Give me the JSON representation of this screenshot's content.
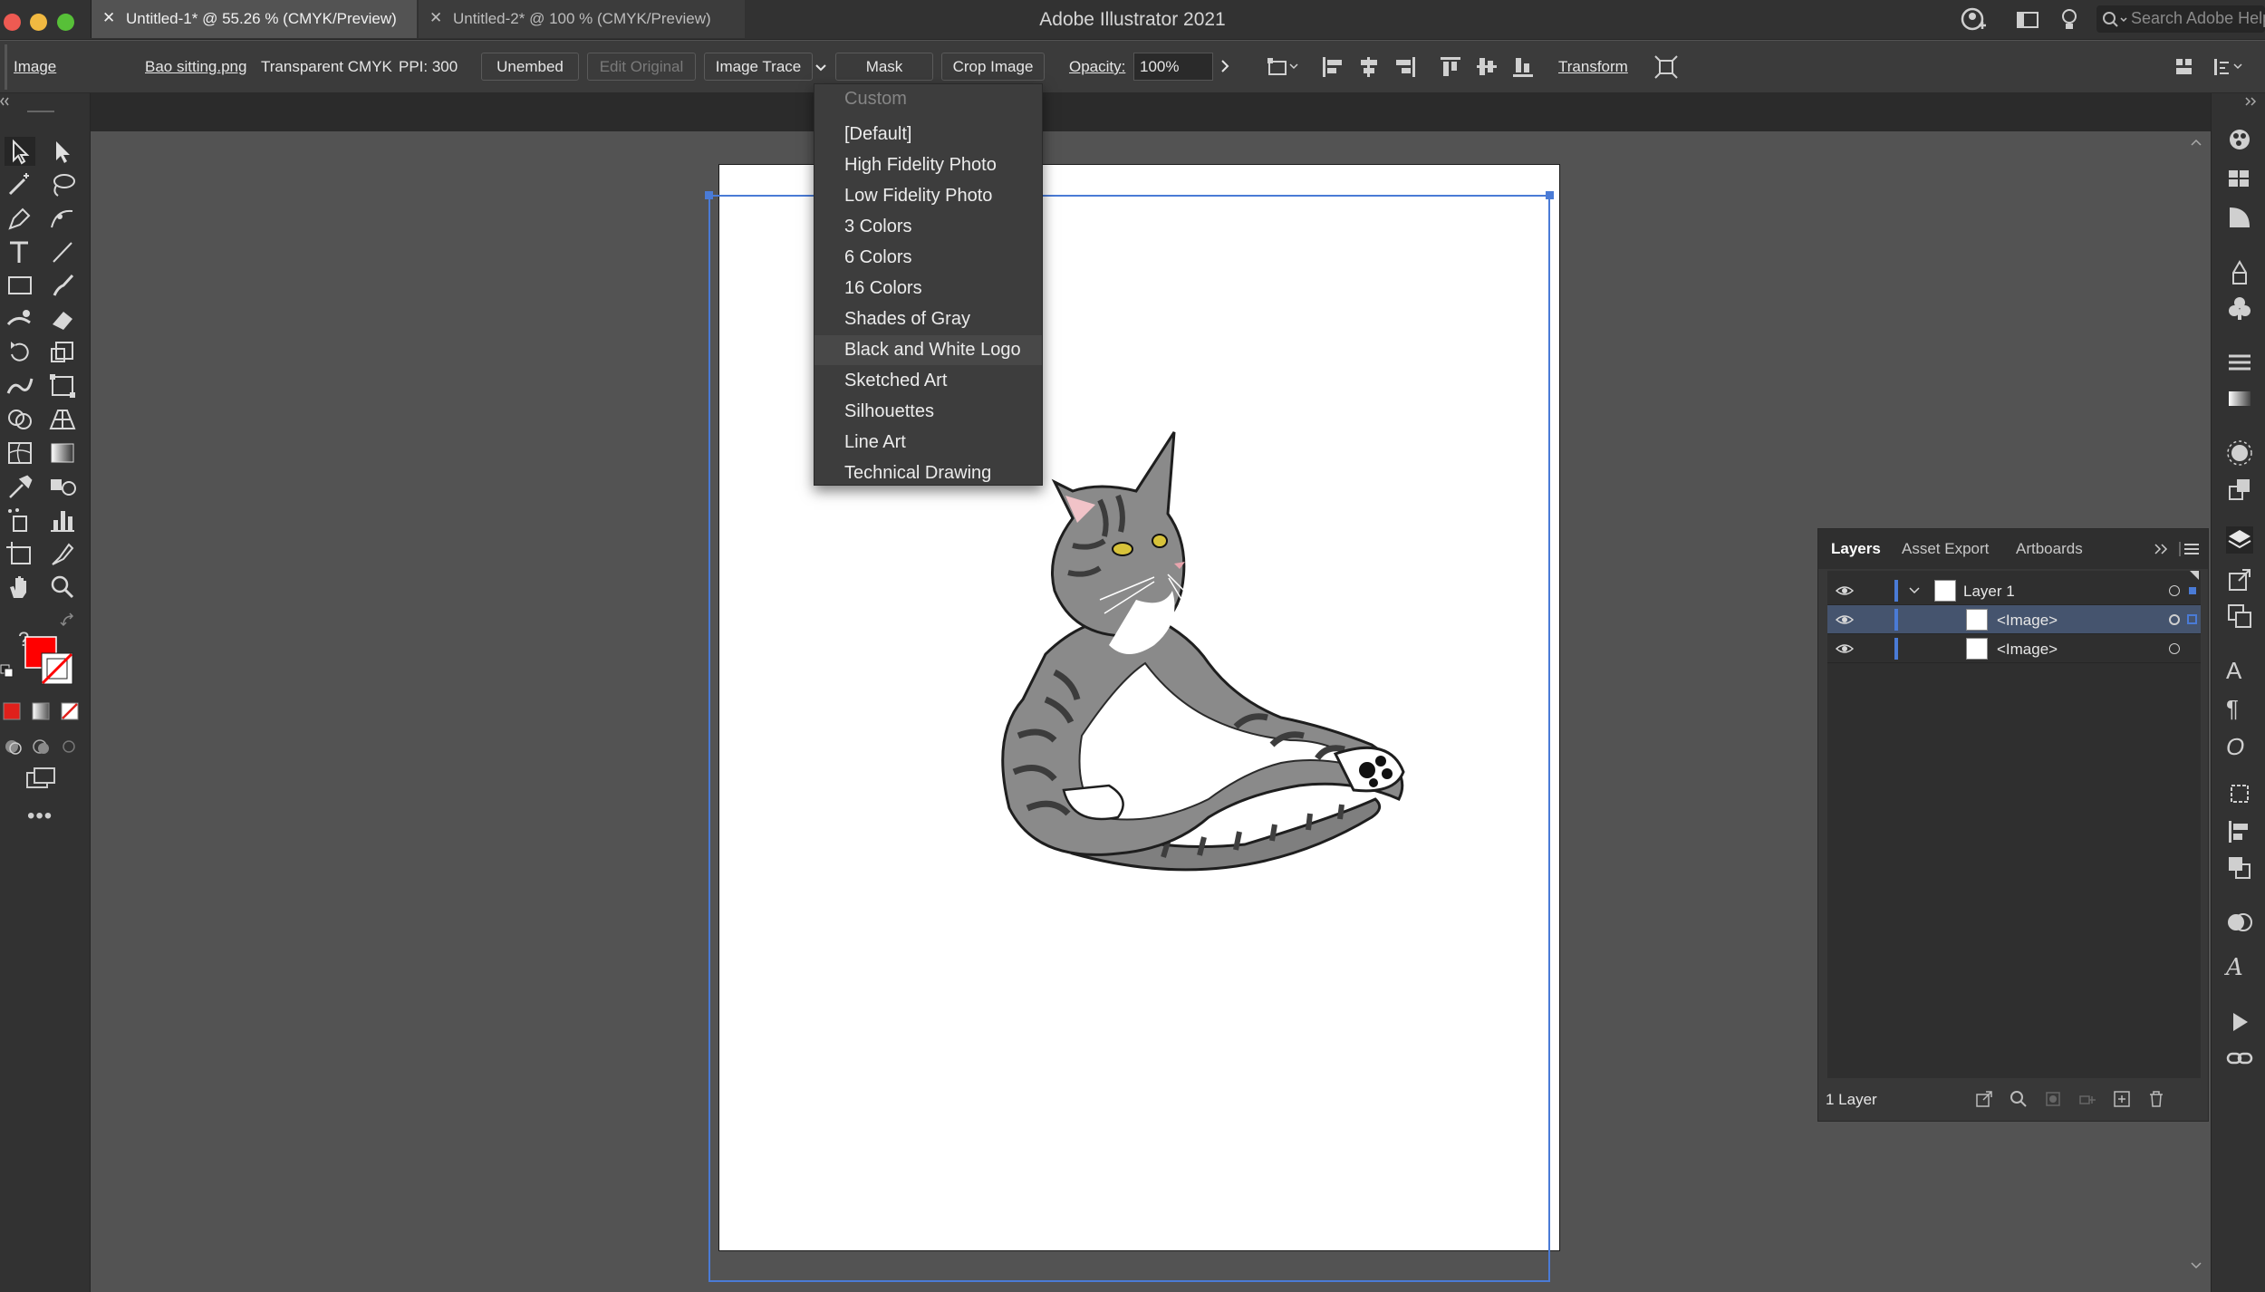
{
  "window": {
    "title": "Adobe Illustrator 2021",
    "search_placeholder": "Search Adobe Help"
  },
  "control_bar": {
    "object_type": "Image",
    "filename": "Bao sitting.png",
    "color_mode": "Transparent CMYK",
    "ppi": "PPI: 300",
    "unembed": "Unembed",
    "edit_original": "Edit Original",
    "image_trace": "Image Trace",
    "mask": "Mask",
    "crop_image": "Crop Image",
    "opacity_label": "Opacity:",
    "opacity_value": "100%",
    "transform": "Transform"
  },
  "tabs": [
    {
      "label": "Untitled-1* @ 55.26 % (CMYK/Preview)",
      "active": true
    },
    {
      "label": "Untitled-2* @ 100 % (CMYK/Preview)",
      "active": false
    }
  ],
  "trace_menu": {
    "items": [
      {
        "label": "Custom",
        "disabled": true
      },
      {
        "label": "[Default]"
      },
      {
        "label": "High Fidelity Photo"
      },
      {
        "label": "Low Fidelity Photo"
      },
      {
        "label": "3 Colors"
      },
      {
        "label": "6 Colors"
      },
      {
        "label": "16 Colors"
      },
      {
        "label": "Shades of Gray"
      },
      {
        "label": "Black and White Logo",
        "highlighted": true
      },
      {
        "label": "Sketched Art"
      },
      {
        "label": "Silhouettes"
      },
      {
        "label": "Line Art"
      },
      {
        "label": "Technical Drawing"
      }
    ]
  },
  "layers_panel": {
    "tabs": [
      "Layers",
      "Asset Export",
      "Artboards"
    ],
    "rows": [
      {
        "name": "Layer 1",
        "expanded": true,
        "selected": false
      },
      {
        "name": "<Image>",
        "selected": true
      },
      {
        "name": "<Image>",
        "selected": false
      }
    ],
    "footer": "1 Layer"
  },
  "colors": {
    "accent": "#4a7bd6",
    "fill": "#ff0000",
    "stroke": "none"
  }
}
